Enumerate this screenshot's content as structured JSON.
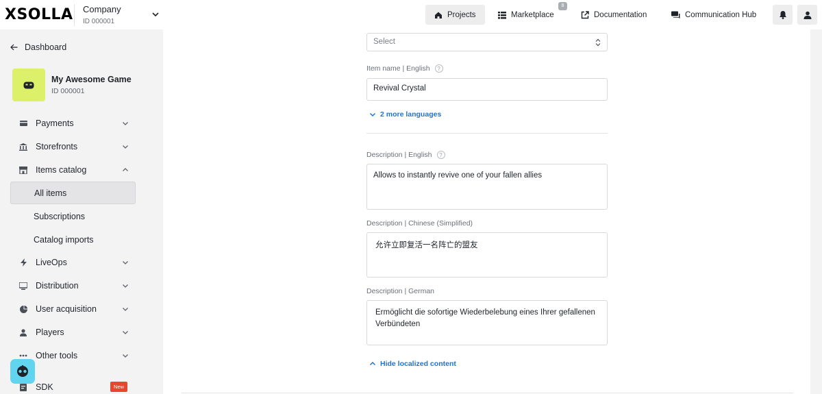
{
  "brand": {
    "logo_text": "XSOLLA"
  },
  "company": {
    "name": "Company",
    "id": "ID 000001"
  },
  "topnav": {
    "projects": "Projects",
    "marketplace": "Marketplace",
    "marketplace_count": "8",
    "documentation": "Documentation",
    "communication_hub": "Communication Hub"
  },
  "sidebar": {
    "back_label": "Dashboard",
    "game": {
      "name": "My Awesome Game",
      "id": "ID 000001"
    },
    "items": [
      {
        "label": "Payments",
        "icon": "wallet-icon"
      },
      {
        "label": "Storefronts",
        "icon": "bank-icon"
      },
      {
        "label": "Items catalog",
        "icon": "store-icon"
      },
      {
        "label": "LiveOps",
        "icon": "lightning-icon"
      },
      {
        "label": "Distribution",
        "icon": "distribution-icon"
      },
      {
        "label": "User acquisition",
        "icon": "acquisition-icon"
      },
      {
        "label": "Players",
        "icon": "person-icon"
      },
      {
        "label": "Other tools",
        "icon": "dots-icon"
      },
      {
        "label": "SDK",
        "icon": "sdk-icon"
      }
    ],
    "subitems": [
      "All items",
      "Subscriptions",
      "Catalog imports"
    ],
    "new_badge": "New"
  },
  "form": {
    "select_placeholder": "Select",
    "item_name_label": "Item name | English",
    "item_name_value": "Revival Crystal",
    "more_languages": "2 more languages",
    "desc_en_label": "Description | English",
    "desc_en_value": "Allows to instantly revive one of your fallen allies",
    "desc_zh_label": "Description | Chinese (Simplified)",
    "desc_zh_value": "允许立即复活一名阵亡的盟友",
    "desc_de_label": "Description | German",
    "desc_de_value": "Ermöglicht die sofortige Wiederbelebung eines Ihrer gefallenen Verbündeten",
    "hide_localized": "Hide localized content",
    "help_glyph": "?"
  },
  "colors": {
    "accent": "#1b74d6",
    "game_tile": "#dcf06a",
    "new_badge": "#e8472f",
    "bot": "#61d4f0"
  }
}
